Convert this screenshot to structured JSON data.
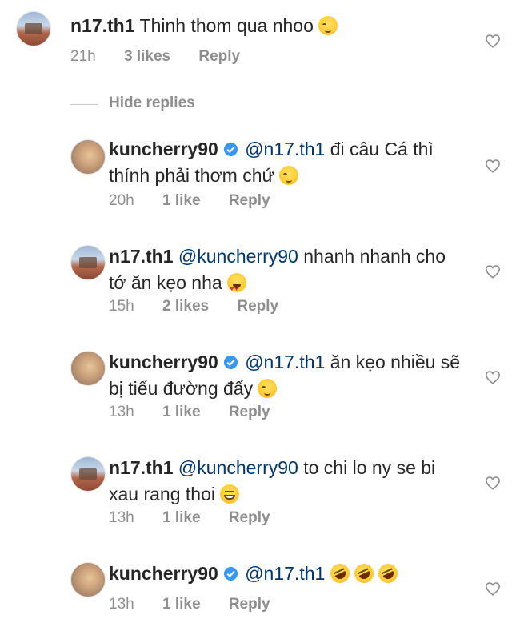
{
  "thread": {
    "parent": {
      "username": "n17.th1",
      "text": "Thinh thom qua nhoo",
      "emoji": [
        "relieved-face"
      ],
      "time": "21h",
      "likes": "3 likes",
      "reply": "Reply"
    },
    "hide_replies_label": "Hide replies",
    "replies": [
      {
        "username": "kuncherry90",
        "verified": true,
        "mention": "@n17.th1",
        "text_line1": "đi câu Cá thì",
        "text_line2": "thính phải thơm chứ",
        "emoji": [
          "relieved-face"
        ],
        "time": "20h",
        "likes": "1 like",
        "reply": "Reply"
      },
      {
        "username": "n17.th1",
        "verified": false,
        "mention": "@kuncherry90",
        "text_line1": "nhanh nhanh cho",
        "text_line2": "tớ ăn kẹo nha",
        "emoji": [
          "heart-eyes-face"
        ],
        "time": "15h",
        "likes": "2 likes",
        "reply": "Reply"
      },
      {
        "username": "kuncherry90",
        "verified": true,
        "mention": "@n17.th1",
        "text_line1": "ăn kẹo nhiều sẽ",
        "text_line2": "bị tiểu đường đấy",
        "emoji": [
          "relieved-face"
        ],
        "time": "13h",
        "likes": "1 like",
        "reply": "Reply"
      },
      {
        "username": "n17.th1",
        "verified": false,
        "mention": "@kuncherry90",
        "text_line1": "to chi lo ny se bi",
        "text_line2": "xau rang thoi",
        "emoji": [
          "grinning-face"
        ],
        "time": "13h",
        "likes": "1 like",
        "reply": "Reply"
      },
      {
        "username": "kuncherry90",
        "verified": true,
        "mention": "@n17.th1",
        "text_line1": "",
        "text_line2": "",
        "emoji": [
          "rolling-on-floor-laughing-face",
          "rolling-on-floor-laughing-face",
          "rolling-on-floor-laughing-face"
        ],
        "time": "13h",
        "likes": "1 like",
        "reply": "Reply"
      }
    ]
  },
  "colors": {
    "text": "#262626",
    "meta": "#8e8e8e",
    "mention": "#003569",
    "verified_badge": "#3897f0",
    "divider": "#c7c7c7"
  },
  "icons": {
    "like": "heart-outline-icon",
    "verified": "verified-badge-icon"
  }
}
